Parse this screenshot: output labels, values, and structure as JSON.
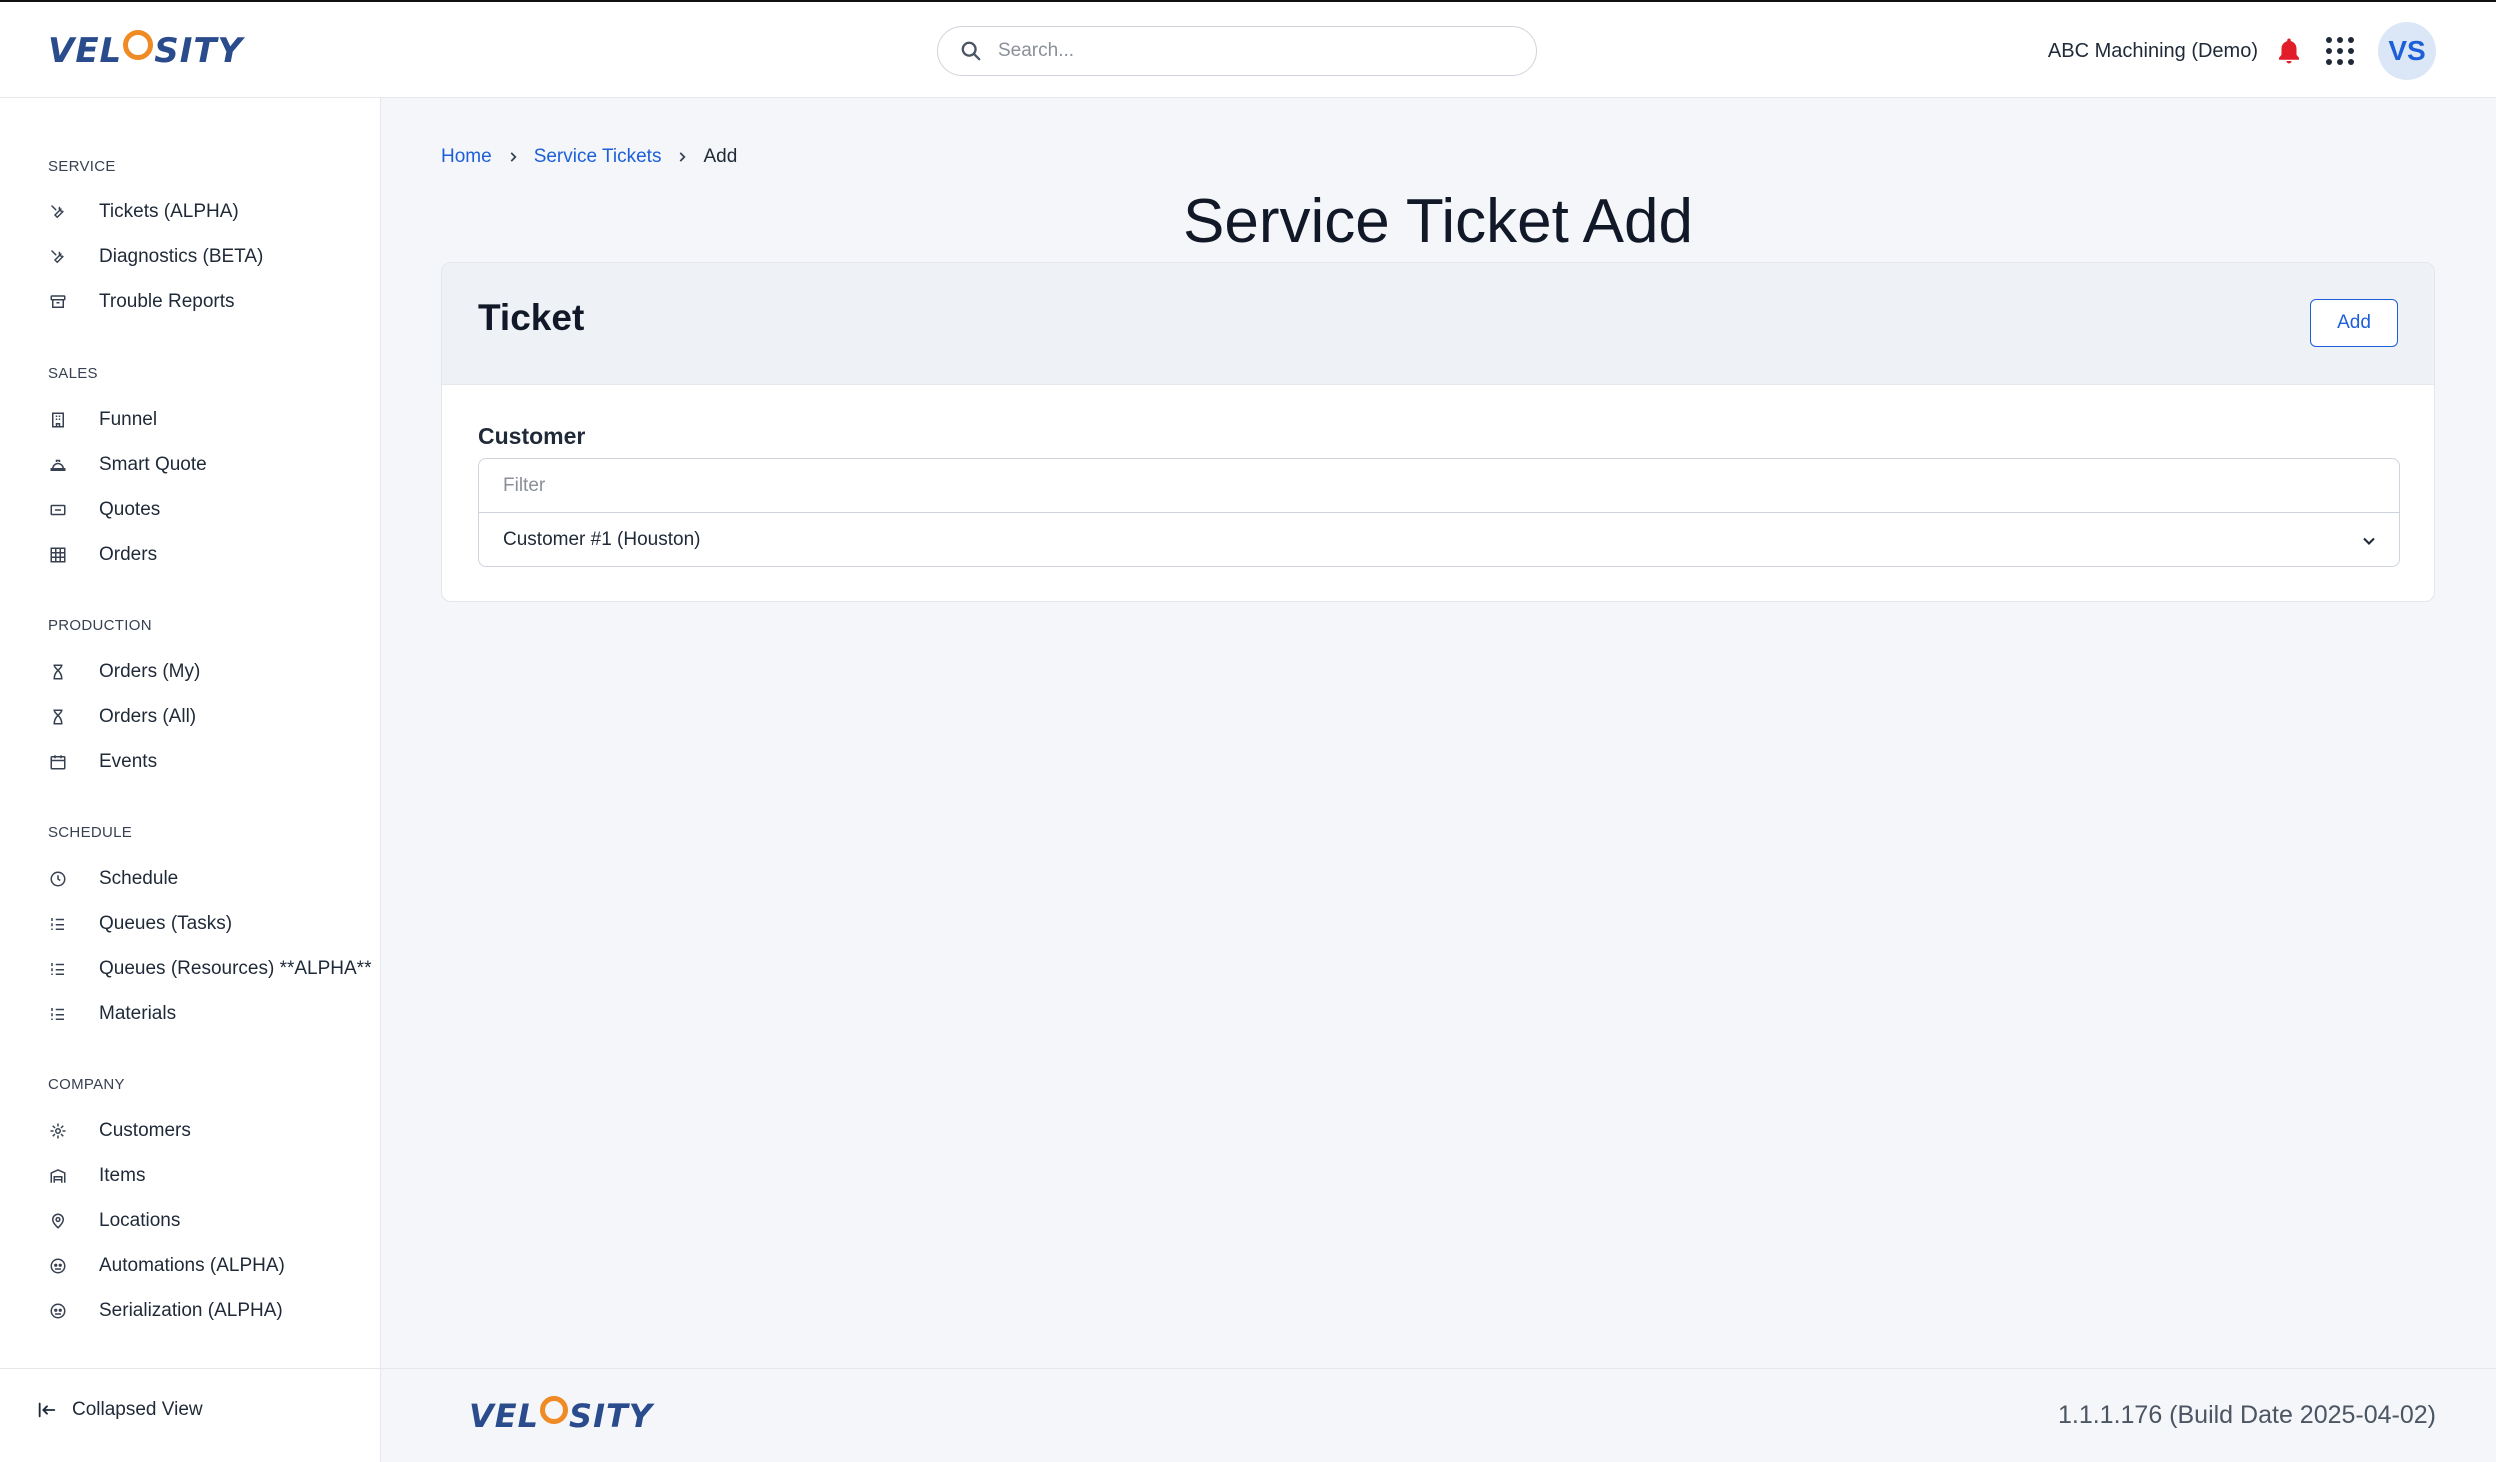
{
  "header": {
    "logo_left": "VEL",
    "logo_right": "SITY",
    "search_placeholder": "Search...",
    "org_name": "ABC Machining (Demo)",
    "avatar_initials": "VS"
  },
  "sidebar": {
    "sections": [
      {
        "title": "SERVICE",
        "items": [
          {
            "label": "Tickets (ALPHA)",
            "icon": "wrench-icon"
          },
          {
            "label": "Diagnostics (BETA)",
            "icon": "wrench-icon"
          },
          {
            "label": "Trouble Reports",
            "icon": "archive-icon"
          }
        ]
      },
      {
        "title": "SALES",
        "items": [
          {
            "label": "Funnel",
            "icon": "building-icon"
          },
          {
            "label": "Smart Quote",
            "icon": "hard-hat-icon"
          },
          {
            "label": "Quotes",
            "icon": "ticket-icon"
          },
          {
            "label": "Orders",
            "icon": "table-icon"
          }
        ]
      },
      {
        "title": "PRODUCTION",
        "items": [
          {
            "label": "Orders (My)",
            "icon": "hourglass-icon"
          },
          {
            "label": "Orders (All)",
            "icon": "hourglass-icon"
          },
          {
            "label": "Events",
            "icon": "calendar-icon"
          }
        ]
      },
      {
        "title": "SCHEDULE",
        "items": [
          {
            "label": "Schedule",
            "icon": "clock-icon"
          },
          {
            "label": "Queues (Tasks)",
            "icon": "list-icon"
          },
          {
            "label": "Queues (Resources) **ALPHA**",
            "icon": "list-icon"
          },
          {
            "label": "Materials",
            "icon": "list-icon"
          }
        ]
      },
      {
        "title": "COMPANY",
        "items": [
          {
            "label": "Customers",
            "icon": "cog-icon"
          },
          {
            "label": "Items",
            "icon": "warehouse-icon"
          },
          {
            "label": "Locations",
            "icon": "map-pin-icon"
          },
          {
            "label": "Automations (ALPHA)",
            "icon": "robot-icon"
          },
          {
            "label": "Serialization (ALPHA)",
            "icon": "robot-icon"
          }
        ]
      }
    ],
    "collapse_label": "Collapsed View"
  },
  "main": {
    "breadcrumb": [
      "Home",
      "Service Tickets",
      "Add"
    ],
    "page_title": "Service Ticket Add",
    "card": {
      "title": "Ticket",
      "add_label": "Add",
      "customer_label": "Customer",
      "filter_placeholder": "Filter",
      "selected_customer": "Customer #1 (Houston)"
    }
  },
  "footer": {
    "logo_left": "VEL",
    "logo_right": "SITY",
    "version": "1.1.1.176 (Build Date 2025-04-02)"
  },
  "colors": {
    "accent": "#1d5fd8",
    "logo_blue": "#2b4c8c",
    "logo_orange": "#f08a24",
    "bell_red": "#e11d2a"
  }
}
